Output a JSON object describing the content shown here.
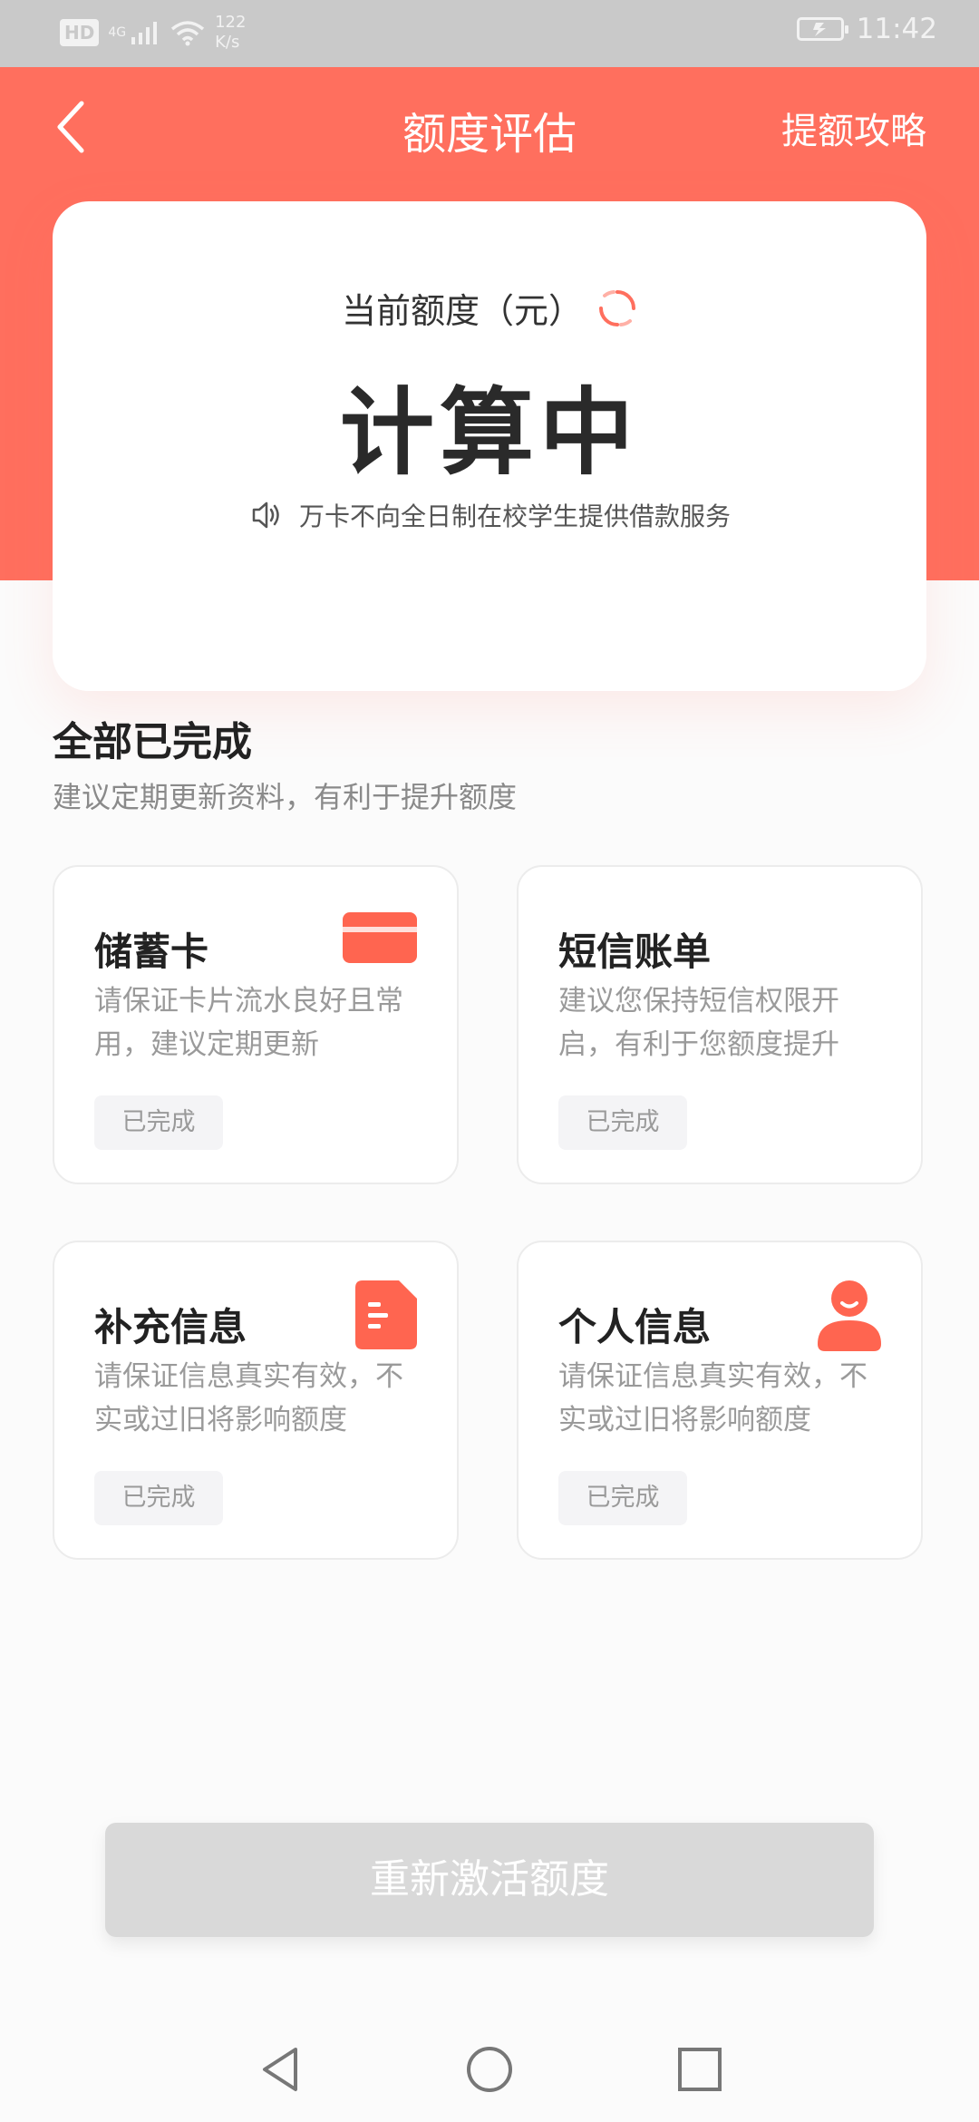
{
  "status_bar": {
    "hd": "HD",
    "network": "4G",
    "speed_value": "122",
    "speed_unit": "K/s",
    "time": "11:42"
  },
  "header": {
    "title": "额度评估",
    "right_link": "提额攻略"
  },
  "quota_card": {
    "label": "当前额度（元）",
    "value": "计算中",
    "notice": "万卡不向全日制在校学生提供借款服务"
  },
  "section": {
    "title": "全部已完成",
    "subtitle": "建议定期更新资料，有利于提升额度"
  },
  "items": [
    {
      "title": "储蓄卡",
      "desc": "请保证卡片流水良好且常用，建议定期更新",
      "status": "已完成",
      "icon": "card-icon"
    },
    {
      "title": "短信账单",
      "desc": "建议您保持短信权限开启，有利于您额度提升",
      "status": "已完成",
      "icon": ""
    },
    {
      "title": "补充信息",
      "desc": "请保证信息真实有效，不实或过旧将影响额度",
      "status": "已完成",
      "icon": "document-icon"
    },
    {
      "title": "个人信息",
      "desc": "请保证信息真实有效，不实或过旧将影响额度",
      "status": "已完成",
      "icon": "person-icon"
    }
  ],
  "button": {
    "label": "重新激活额度"
  },
  "colors": {
    "accent": "#ff6f5e",
    "disabled_button": "#d9d9d9"
  }
}
